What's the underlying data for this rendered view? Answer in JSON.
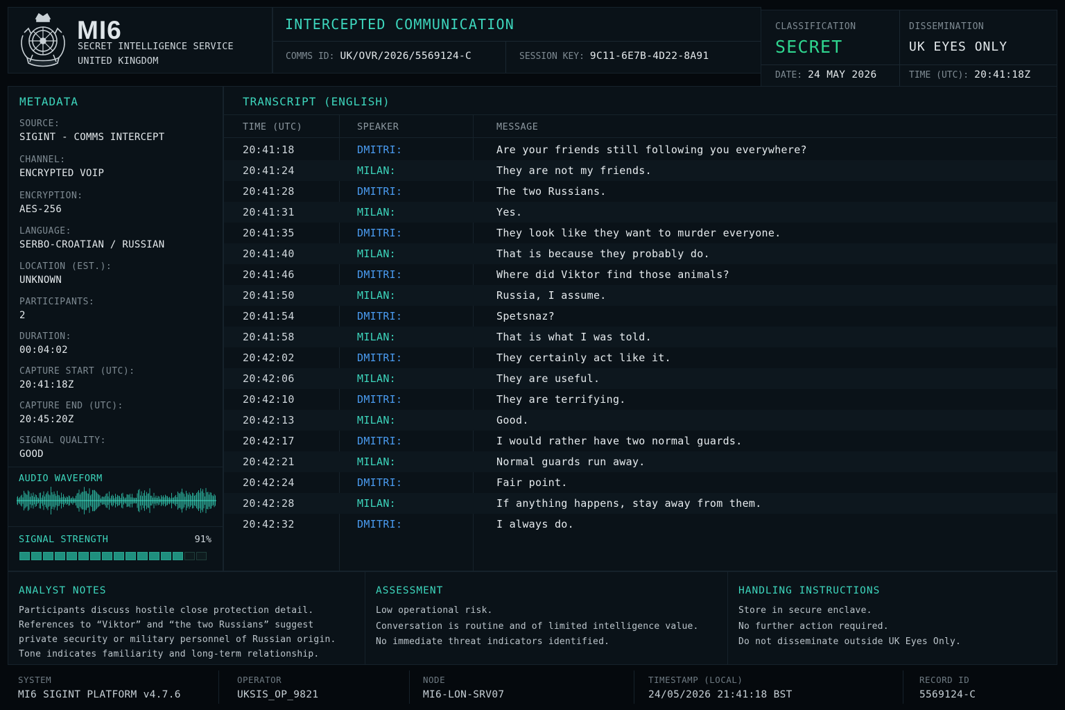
{
  "header": {
    "brand": {
      "title": "MI6",
      "subtitle_line1": "SECRET INTELLIGENCE SERVICE",
      "subtitle_line2": "UNITED KINGDOM",
      "crest_icon": "royal-crest-icon"
    },
    "intercept": {
      "title": "INTERCEPTED COMMUNICATION",
      "comms_id_label": "COMMS ID:",
      "comms_id": "UK/OVR/2026/5569124-C",
      "session_key_label": "SESSION KEY:",
      "session_key": "9C11-6E7B-4D22-8A91"
    },
    "classification": {
      "label": "CLASSIFICATION",
      "value": "SECRET",
      "value_color": "#2fd58f",
      "dissemination_label": "DISSEMINATION",
      "dissemination_value": "UK EYES ONLY",
      "date_label": "DATE:",
      "date_value": "24 MAY 2026",
      "time_label": "TIME (UTC):",
      "time_value": "20:41:18Z"
    }
  },
  "metadata": {
    "title": "METADATA",
    "items": [
      {
        "label": "SOURCE:",
        "value": "SIGINT - COMMS INTERCEPT"
      },
      {
        "label": "CHANNEL:",
        "value": "ENCRYPTED VOIP"
      },
      {
        "label": "ENCRYPTION:",
        "value": "AES-256"
      },
      {
        "label": "LANGUAGE:",
        "value": "SERBO-CROATIAN / RUSSIAN"
      },
      {
        "label": "LOCATION (EST.):",
        "value": "UNKNOWN"
      },
      {
        "label": "PARTICIPANTS:",
        "value": "2"
      },
      {
        "label": "DURATION:",
        "value": "00:04:02"
      },
      {
        "label": "CAPTURE START (UTC):",
        "value": "20:41:18Z"
      },
      {
        "label": "CAPTURE END (UTC):",
        "value": "20:45:20Z"
      },
      {
        "label": "SIGNAL QUALITY:",
        "value": "GOOD"
      }
    ],
    "audio_waveform_title": "AUDIO WAVEFORM",
    "signal_strength_title": "SIGNAL STRENGTH",
    "signal_strength_pct": "91%",
    "signal_strength_fraction": 0.91
  },
  "transcript": {
    "title": "TRANSCRIPT (ENGLISH)",
    "columns": [
      "TIME (UTC)",
      "SPEAKER",
      "MESSAGE"
    ],
    "rows": [
      {
        "time": "20:41:18",
        "speaker": "DMITRI:",
        "message": "Are your friends still following you everywhere?"
      },
      {
        "time": "20:41:24",
        "speaker": "MILAN:",
        "message": "They are not my friends."
      },
      {
        "time": "20:41:28",
        "speaker": "DMITRI:",
        "message": "The two Russians."
      },
      {
        "time": "20:41:31",
        "speaker": "MILAN:",
        "message": "Yes."
      },
      {
        "time": "20:41:35",
        "speaker": "DMITRI:",
        "message": "They look like they want to murder everyone."
      },
      {
        "time": "20:41:40",
        "speaker": "MILAN:",
        "message": "That is because they probably do."
      },
      {
        "time": "20:41:46",
        "speaker": "DMITRI:",
        "message": "Where did Viktor find those animals?"
      },
      {
        "time": "20:41:50",
        "speaker": "MILAN:",
        "message": "Russia, I assume."
      },
      {
        "time": "20:41:54",
        "speaker": "DMITRI:",
        "message": "Spetsnaz?"
      },
      {
        "time": "20:41:58",
        "speaker": "MILAN:",
        "message": "That is what I was told."
      },
      {
        "time": "20:42:02",
        "speaker": "DMITRI:",
        "message": "They certainly act like it."
      },
      {
        "time": "20:42:06",
        "speaker": "MILAN:",
        "message": "They are useful."
      },
      {
        "time": "20:42:10",
        "speaker": "DMITRI:",
        "message": "They are terrifying."
      },
      {
        "time": "20:42:13",
        "speaker": "MILAN:",
        "message": "Good."
      },
      {
        "time": "20:42:17",
        "speaker": "DMITRI:",
        "message": "I would rather have two normal guards."
      },
      {
        "time": "20:42:21",
        "speaker": "MILAN:",
        "message": "Normal guards run away."
      },
      {
        "time": "20:42:24",
        "speaker": "DMITRI:",
        "message": "Fair point."
      },
      {
        "time": "20:42:28",
        "speaker": "MILAN:",
        "message": "If anything happens, stay away from them."
      },
      {
        "time": "20:42:32",
        "speaker": "DMITRI:",
        "message": "I always do."
      }
    ],
    "speaker_colors": {
      "DMITRI:": "#4a9bf0",
      "MILAN:": "#3dd6bd"
    }
  },
  "analyst_notes": {
    "title": "ANALYST NOTES",
    "lines": [
      "Participants discuss hostile close protection detail.",
      "References to “Viktor” and “the two Russians” suggest",
      "private security or military personnel of Russian origin.",
      "Tone indicates familiarity and long-term relationship."
    ]
  },
  "assessment": {
    "title": "ASSESSMENT",
    "lines": [
      "Low operational risk.",
      "Conversation is routine and of limited intelligence value.",
      "No immediate threat indicators identified."
    ]
  },
  "handling": {
    "title": "HANDLING INSTRUCTIONS",
    "lines": [
      "Store in secure enclave.",
      "No further action required.",
      "Do not disseminate outside UK Eyes Only."
    ]
  },
  "footer": {
    "system_label": "SYSTEM",
    "system_value": "MI6 SIGINT PLATFORM v4.7.6",
    "operator_label": "OPERATOR",
    "operator_value": "UKSIS_OP_9821",
    "node_label": "NODE",
    "node_value": "MI6-LON-SRV07",
    "timestamp_label": "TIMESTAMP (LOCAL)",
    "timestamp_value": "24/05/2026 21:41:18 BST",
    "record_label": "RECORD ID",
    "record_value": "5569124-C"
  },
  "colors": {
    "accent": "#3dd6bd",
    "classification": "#2fd58f",
    "background": "#05090d",
    "panel": "#0a1218"
  }
}
